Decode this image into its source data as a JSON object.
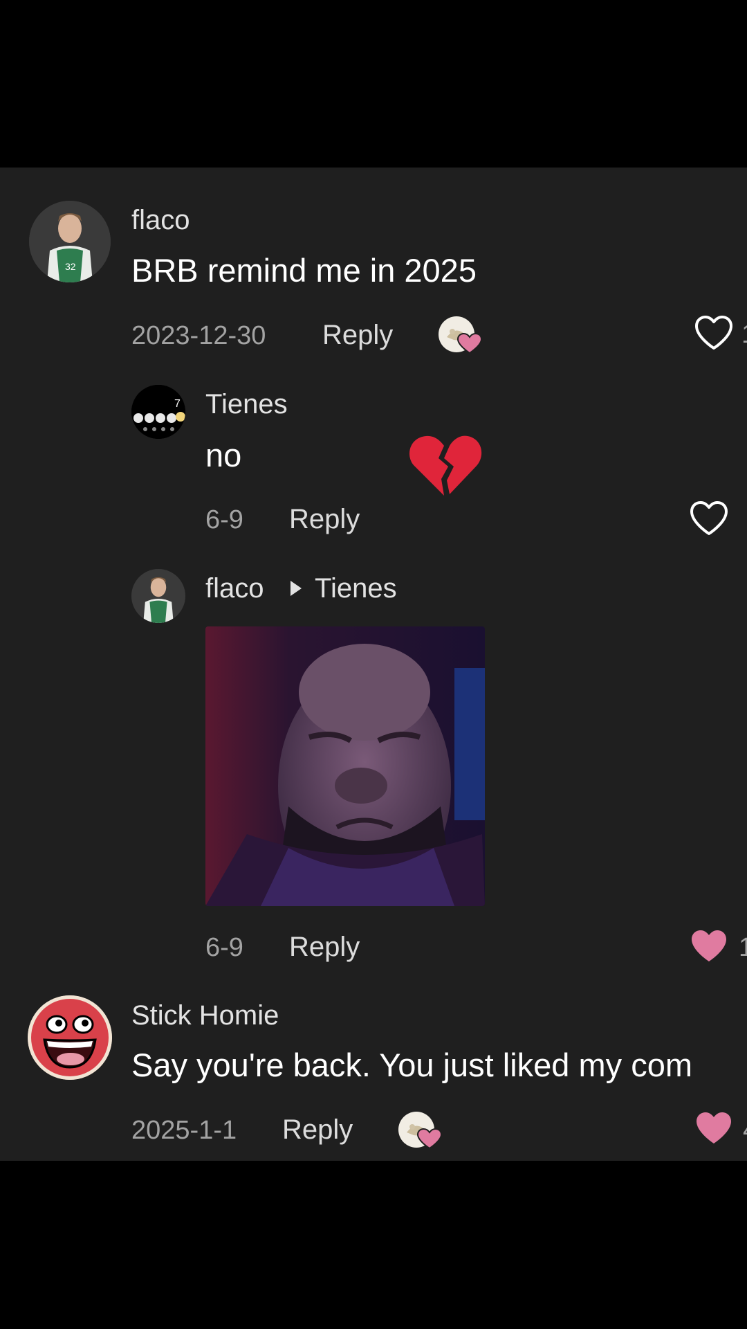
{
  "colors": {
    "panel_bg": "#1f1f1f",
    "liked_pink": "#e07ba0",
    "text_secondary": "#a3a3a3"
  },
  "comments": [
    {
      "username": "flaco",
      "text": "BRB remind me in 2025",
      "date": "2023-12-30",
      "reply_label": "Reply",
      "avatar_icon": "basketball-player-avatar",
      "liked_by_creator": true,
      "liked": false,
      "like_count": "1"
    },
    {
      "username": "Tienes",
      "text": "no",
      "emoji": "💔",
      "date": "6-9",
      "reply_label": "Reply",
      "avatar_icon": "dots-avatar",
      "avatar_number": "7",
      "liked": false
    },
    {
      "username": "flaco",
      "reply_to": "Tienes",
      "media": "gif-crying-man",
      "date": "6-9",
      "reply_label": "Reply",
      "avatar_icon": "basketball-player-avatar",
      "liked": true,
      "like_count": "1"
    },
    {
      "username": "Stick Homie",
      "text": "Say you're back. You just liked my com",
      "date": "2025-1-1",
      "reply_label": "Reply",
      "avatar_icon": "smiley-face-avatar",
      "liked_by_creator": true,
      "liked": true,
      "like_count": "4"
    }
  ]
}
